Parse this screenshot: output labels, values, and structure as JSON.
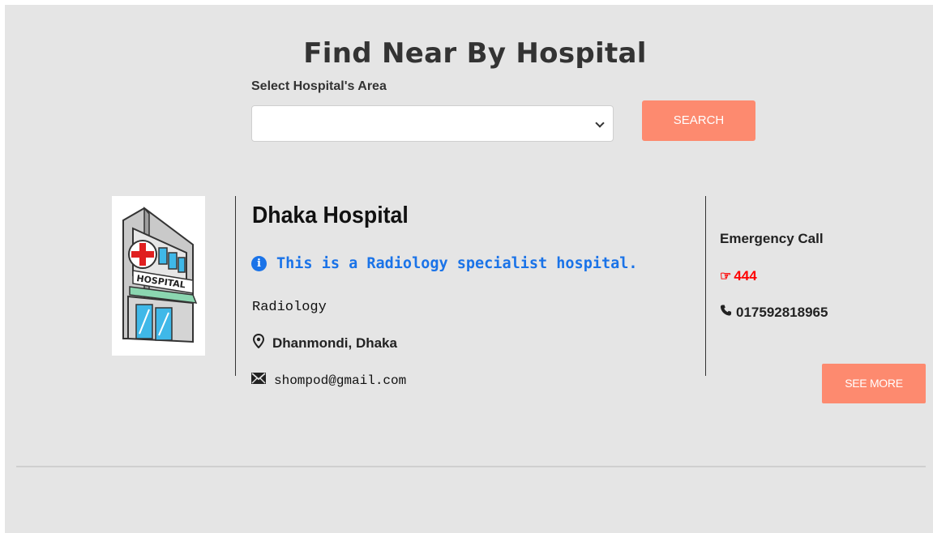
{
  "page": {
    "title": "Find Near By Hospital",
    "area_label": "Select Hospital's Area",
    "area_select_value": "",
    "search_button": "SEARCH"
  },
  "hospital": {
    "name": "Dhaka Hospital",
    "logo_text": "HOSPITAL",
    "info_text": "This is a Radiology specialist hospital.",
    "specialty": "Radiology",
    "address": "Dhanmondi, Dhaka",
    "email": "shompod@gmail.com",
    "emergency_label": "Emergency Call",
    "emergency_number": "444",
    "phone": "017592818965",
    "see_more": "SEE MORE"
  },
  "colors": {
    "background": "#e5e5e5",
    "button": "#fd8a6f",
    "info_blue": "#1a73e8",
    "emergency_red": "#ff0000"
  },
  "icons": {
    "info": "info-circle-icon",
    "address": "map-marker-icon",
    "email": "envelope-icon",
    "emergency": "hand-pointing-icon",
    "phone": "phone-icon",
    "select": "chevron-down-icon"
  }
}
